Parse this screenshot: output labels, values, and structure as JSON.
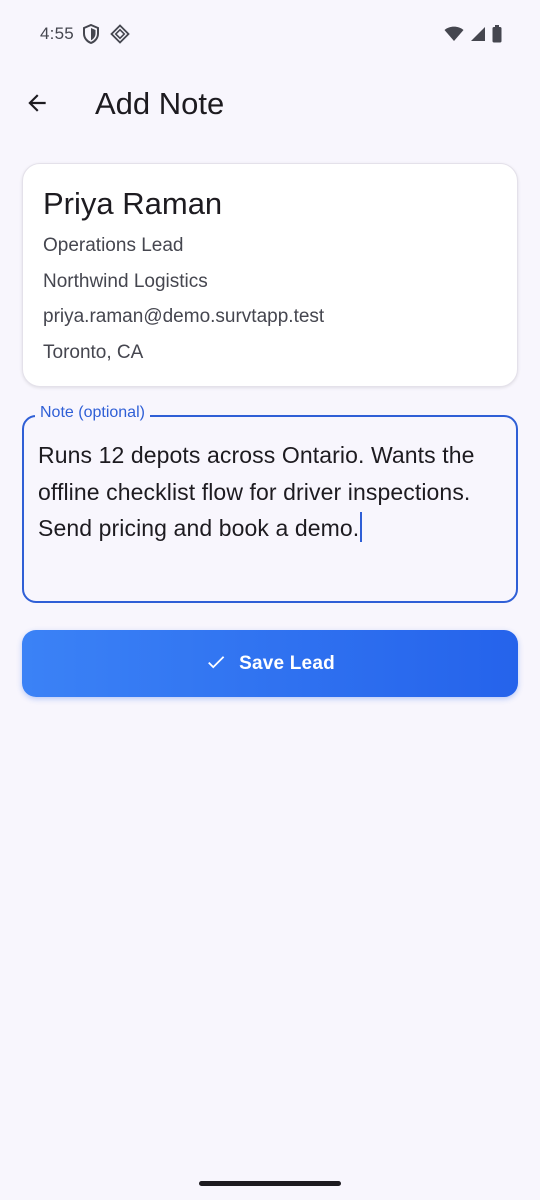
{
  "status_bar": {
    "time": "4:55",
    "icons": [
      "shield-icon",
      "vpn-key-icon",
      "wifi-icon",
      "signal-icon",
      "battery-icon"
    ]
  },
  "app_bar": {
    "back_icon": "arrow-left-icon",
    "title": "Add Note"
  },
  "contact": {
    "name": "Priya Raman",
    "role": "Operations Lead",
    "company": "Northwind Logistics",
    "email": "priya.raman@demo.survtapp.test",
    "location": "Toronto, CA"
  },
  "note": {
    "label": "Note (optional)",
    "value": "Runs 12 depots across Ontario. Wants the offline checklist flow for driver inspections. Send pricing and book a demo."
  },
  "save_button": {
    "icon": "check-icon",
    "label": "Save Lead"
  },
  "colors": {
    "background": "#f8f6fd",
    "accent": "#2f5fd6",
    "button_start": "#3b82f6",
    "button_end": "#2563eb"
  }
}
